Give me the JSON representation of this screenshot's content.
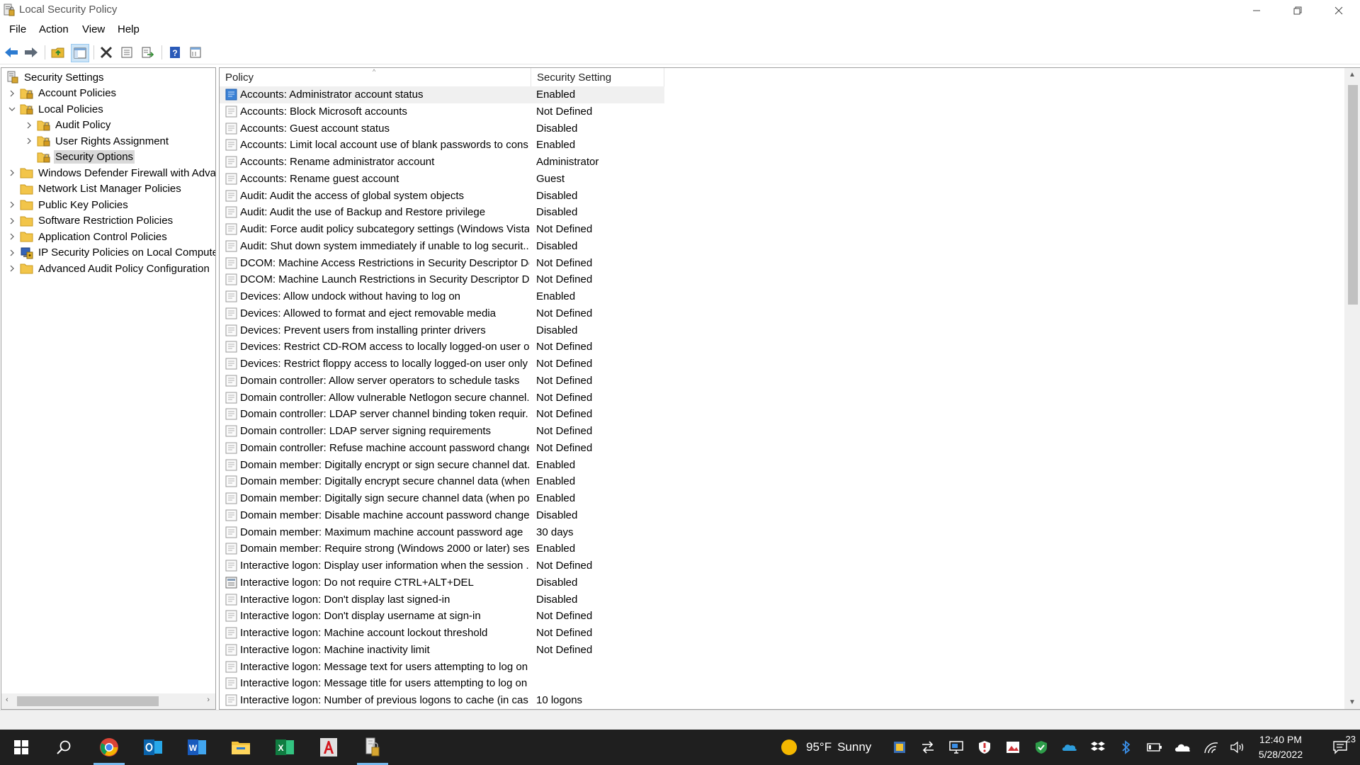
{
  "window": {
    "title": "Local Security Policy",
    "controls": [
      "minimize",
      "restore",
      "close"
    ]
  },
  "menu": {
    "items": [
      "File",
      "Action",
      "View",
      "Help"
    ]
  },
  "toolbar": {
    "buttons": [
      {
        "name": "back-icon"
      },
      {
        "name": "forward-icon"
      },
      {
        "name": "up-folder-icon"
      },
      {
        "name": "show-hide-tree-icon"
      },
      {
        "name": "delete-icon"
      },
      {
        "name": "properties-icon"
      },
      {
        "name": "export-list-icon"
      },
      {
        "name": "help-icon"
      },
      {
        "name": "view-icon"
      }
    ]
  },
  "tree": {
    "root": "Security Settings",
    "items": [
      {
        "label": "Account Policies",
        "level": 1,
        "expander": "collapsed",
        "icon": "folder-lock-icon"
      },
      {
        "label": "Local Policies",
        "level": 1,
        "expander": "expanded",
        "icon": "folder-lock-icon"
      },
      {
        "label": "Audit Policy",
        "level": 2,
        "expander": "collapsed",
        "icon": "folder-lock-icon"
      },
      {
        "label": "User Rights Assignment",
        "level": 2,
        "expander": "collapsed",
        "icon": "folder-lock-icon"
      },
      {
        "label": "Security Options",
        "level": 2,
        "expander": "none",
        "icon": "folder-lock-icon",
        "selected": true
      },
      {
        "label": "Windows Defender Firewall with Advanced Security",
        "level": 1,
        "expander": "collapsed",
        "icon": "folder-icon"
      },
      {
        "label": "Network List Manager Policies",
        "level": 1,
        "expander": "none",
        "icon": "folder-icon"
      },
      {
        "label": "Public Key Policies",
        "level": 1,
        "expander": "collapsed",
        "icon": "folder-icon"
      },
      {
        "label": "Software Restriction Policies",
        "level": 1,
        "expander": "collapsed",
        "icon": "folder-icon"
      },
      {
        "label": "Application Control Policies",
        "level": 1,
        "expander": "collapsed",
        "icon": "folder-icon"
      },
      {
        "label": "IP Security Policies on Local Computer",
        "level": 1,
        "expander": "collapsed",
        "icon": "ip-security-icon"
      },
      {
        "label": "Advanced Audit Policy Configuration",
        "level": 1,
        "expander": "collapsed",
        "icon": "folder-icon"
      }
    ]
  },
  "list": {
    "columns": [
      "Policy",
      "Security Setting"
    ],
    "rows": [
      {
        "policy": "Accounts: Administrator account status",
        "setting": "Enabled",
        "highlight": true
      },
      {
        "policy": "Accounts: Block Microsoft accounts",
        "setting": "Not Defined"
      },
      {
        "policy": "Accounts: Guest account status",
        "setting": "Disabled"
      },
      {
        "policy": "Accounts: Limit local account use of blank passwords to cons...",
        "setting": "Enabled"
      },
      {
        "policy": "Accounts: Rename administrator account",
        "setting": "Administrator"
      },
      {
        "policy": "Accounts: Rename guest account",
        "setting": "Guest"
      },
      {
        "policy": "Audit: Audit the access of global system objects",
        "setting": "Disabled"
      },
      {
        "policy": "Audit: Audit the use of Backup and Restore privilege",
        "setting": "Disabled"
      },
      {
        "policy": "Audit: Force audit policy subcategory settings (Windows Vista...",
        "setting": "Not Defined"
      },
      {
        "policy": "Audit: Shut down system immediately if unable to log securit...",
        "setting": "Disabled"
      },
      {
        "policy": "DCOM: Machine Access Restrictions in Security Descriptor Def...",
        "setting": "Not Defined"
      },
      {
        "policy": "DCOM: Machine Launch Restrictions in Security Descriptor De...",
        "setting": "Not Defined"
      },
      {
        "policy": "Devices: Allow undock without having to log on",
        "setting": "Enabled"
      },
      {
        "policy": "Devices: Allowed to format and eject removable media",
        "setting": "Not Defined"
      },
      {
        "policy": "Devices: Prevent users from installing printer drivers",
        "setting": "Disabled"
      },
      {
        "policy": "Devices: Restrict CD-ROM access to locally logged-on user on...",
        "setting": "Not Defined"
      },
      {
        "policy": "Devices: Restrict floppy access to locally logged-on user only",
        "setting": "Not Defined"
      },
      {
        "policy": "Domain controller: Allow server operators to schedule tasks",
        "setting": "Not Defined"
      },
      {
        "policy": "Domain controller: Allow vulnerable Netlogon secure channel...",
        "setting": "Not Defined"
      },
      {
        "policy": "Domain controller: LDAP server channel binding token requir...",
        "setting": "Not Defined"
      },
      {
        "policy": "Domain controller: LDAP server signing requirements",
        "setting": "Not Defined"
      },
      {
        "policy": "Domain controller: Refuse machine account password changes",
        "setting": "Not Defined"
      },
      {
        "policy": "Domain member: Digitally encrypt or sign secure channel dat...",
        "setting": "Enabled"
      },
      {
        "policy": "Domain member: Digitally encrypt secure channel data (when...",
        "setting": "Enabled"
      },
      {
        "policy": "Domain member: Digitally sign secure channel data (when po...",
        "setting": "Enabled"
      },
      {
        "policy": "Domain member: Disable machine account password changes",
        "setting": "Disabled"
      },
      {
        "policy": "Domain member: Maximum machine account password age",
        "setting": "30 days"
      },
      {
        "policy": "Domain member: Require strong (Windows 2000 or later) sess...",
        "setting": "Enabled"
      },
      {
        "policy": "Interactive logon: Display user information when the session ...",
        "setting": "Not Defined"
      },
      {
        "policy": "Interactive logon: Do not require CTRL+ALT+DEL",
        "setting": "Disabled",
        "icon": "policy-alt-icon"
      },
      {
        "policy": "Interactive logon: Don't display last signed-in",
        "setting": "Disabled"
      },
      {
        "policy": "Interactive logon: Don't display username at sign-in",
        "setting": "Not Defined"
      },
      {
        "policy": "Interactive logon: Machine account lockout threshold",
        "setting": "Not Defined"
      },
      {
        "policy": "Interactive logon: Machine inactivity limit",
        "setting": "Not Defined"
      },
      {
        "policy": "Interactive logon: Message text for users attempting to log on",
        "setting": ""
      },
      {
        "policy": "Interactive logon: Message title for users attempting to log on",
        "setting": ""
      },
      {
        "policy": "Interactive logon: Number of previous logons to cache (in cas...",
        "setting": "10 logons"
      }
    ]
  },
  "taskbar": {
    "apps": [
      {
        "name": "chrome-icon",
        "active": true
      },
      {
        "name": "outlook-icon"
      },
      {
        "name": "word-icon"
      },
      {
        "name": "file-explorer-icon"
      },
      {
        "name": "excel-icon"
      },
      {
        "name": "acrobat-icon"
      },
      {
        "name": "local-security-policy-icon",
        "active": true
      }
    ],
    "weather": {
      "temp": "95°F",
      "condition": "Sunny"
    },
    "clock": {
      "time": "12:40 PM",
      "date": "5/28/2022"
    },
    "notifications": "23"
  },
  "colors": {
    "accent": "#0078d7",
    "folder": "#f4c542",
    "selection": "#d9d9d9",
    "taskbar": "#1f1f1f"
  }
}
